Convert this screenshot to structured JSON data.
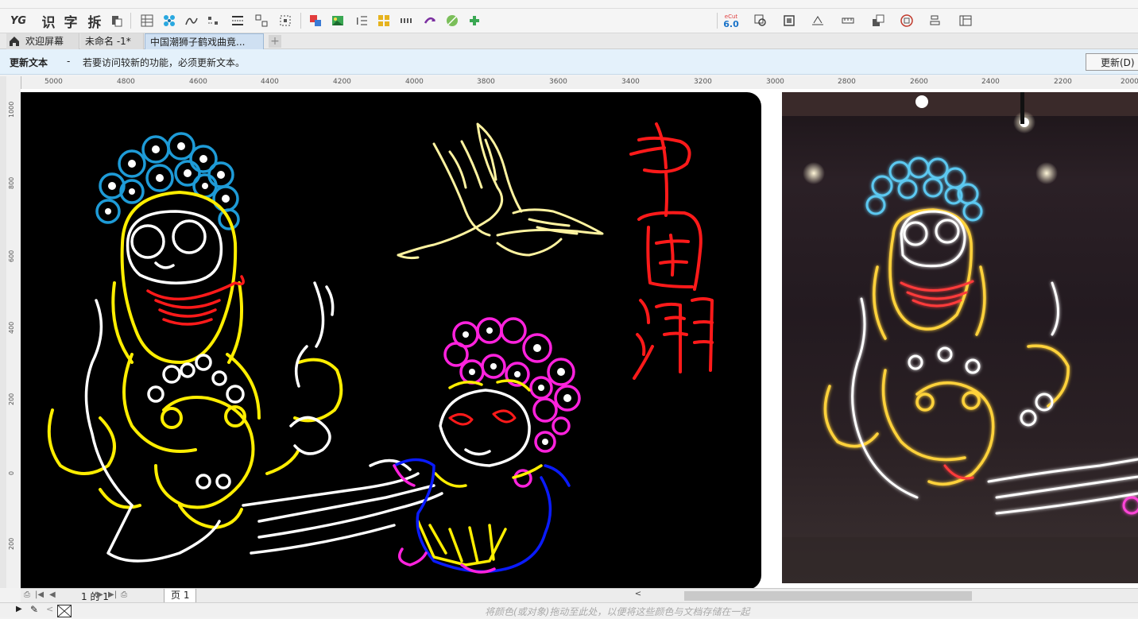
{
  "toolbar": {
    "text_tools": [
      "识",
      "字",
      "拆"
    ],
    "logo": "YG",
    "ecut_badge_top": "eCut",
    "ecut_badge_version": "6.0"
  },
  "tabs": {
    "welcome": "欢迎屏幕",
    "untitled": "未命名 -1*",
    "active": "中国潮狮子鹤戏曲竟..."
  },
  "notice": {
    "title": "更新文本",
    "dash": "-",
    "message": "若要访问较新的功能，必须更新文本。",
    "button": "更新(D)"
  },
  "ruler": {
    "h_labels": [
      "5000",
      "4800",
      "4600",
      "4400",
      "4200",
      "4000",
      "3800",
      "3600",
      "3400",
      "3200",
      "3000",
      "2800",
      "2600",
      "2400",
      "2200",
      "2000"
    ],
    "v_labels": [
      "1000",
      "800",
      "600",
      "400",
      "200",
      "0",
      "200"
    ]
  },
  "artwork": {
    "title_chars": [
      "中",
      "国",
      "潮"
    ]
  },
  "pagebar": {
    "page_info": "1 的 1",
    "page_tab": "页 1"
  },
  "status": {
    "hint": "将颜色(或对象)拖动至此处，以便将这些颜色与文档存储在一起"
  },
  "colors": {
    "neon_yellow": "#ffee00",
    "neon_blue": "#1e9bd7",
    "neon_red": "#ff1a1a",
    "neon_magenta": "#ff22dd",
    "neon_cream": "#fff3a0",
    "canvas_bg": "#000000"
  }
}
